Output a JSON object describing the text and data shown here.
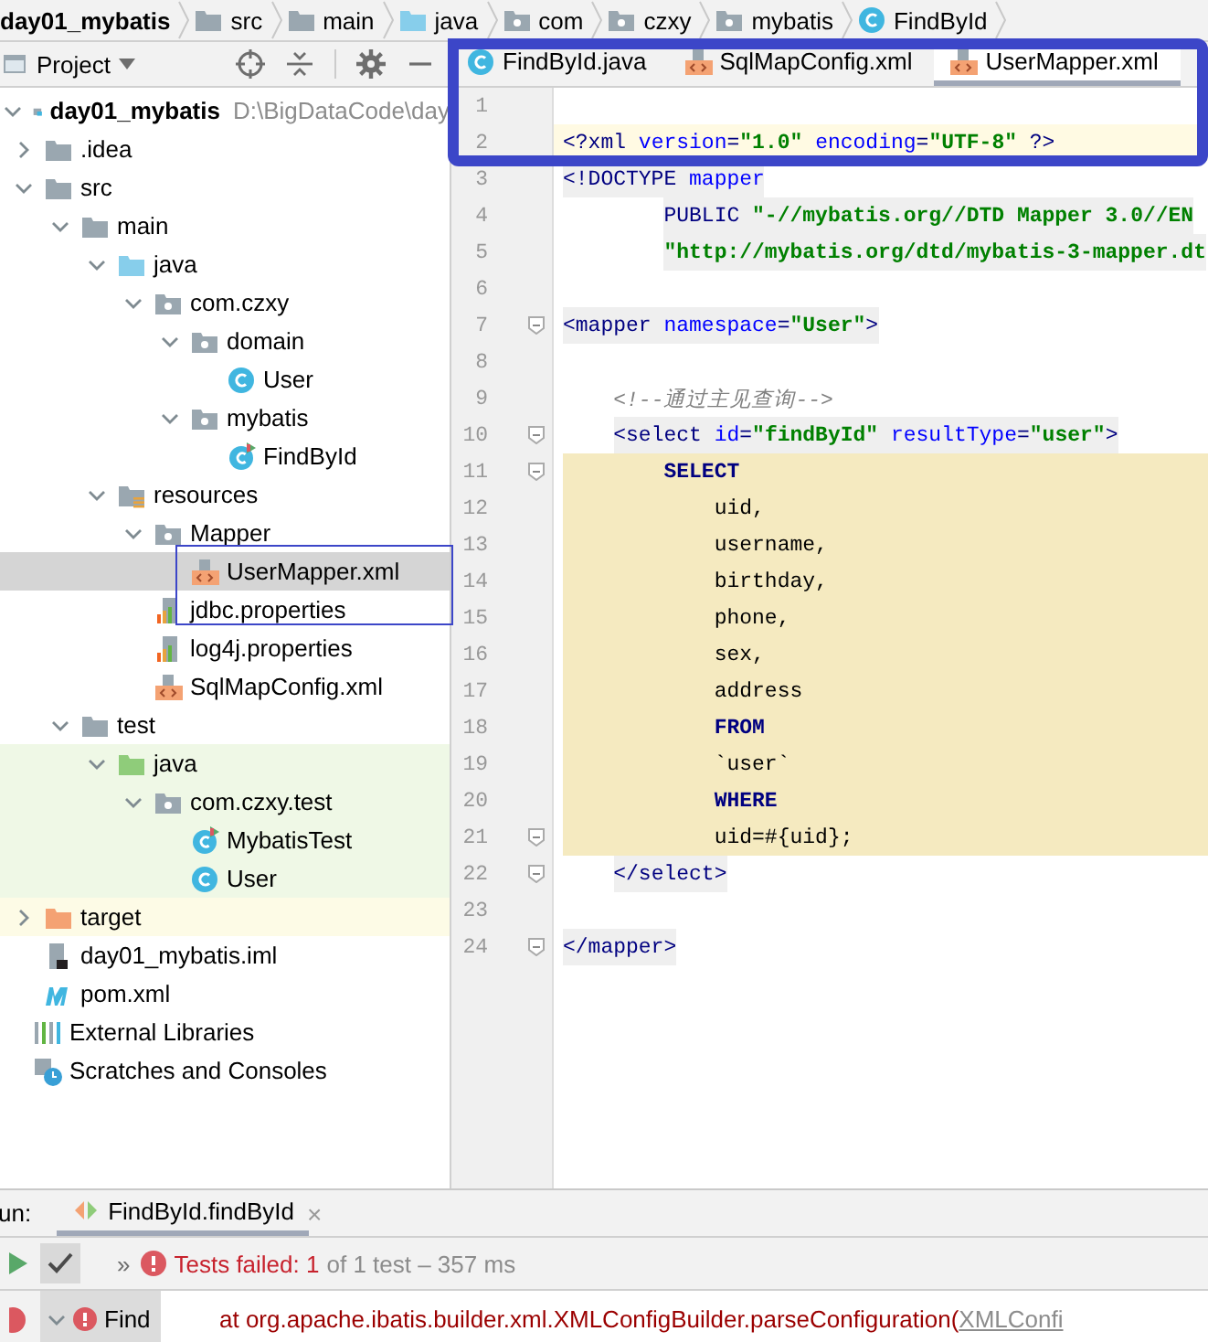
{
  "breadcrumbs": [
    {
      "label": "day01_mybatis"
    },
    {
      "label": "src",
      "kind": "folder"
    },
    {
      "label": "main",
      "kind": "folder"
    },
    {
      "label": "java",
      "kind": "source-root"
    },
    {
      "label": "com",
      "kind": "package"
    },
    {
      "label": "czxy",
      "kind": "package"
    },
    {
      "label": "mybatis",
      "kind": "package"
    },
    {
      "label": "FindById",
      "kind": "class"
    }
  ],
  "project_panel": {
    "title": "Project",
    "tree": [
      {
        "label": "day01_mybatis",
        "path": "D:\\BigDataCode\\day",
        "kind": "module",
        "expanded": true,
        "selected": false,
        "children": [
          {
            "label": ".idea",
            "kind": "folder",
            "expanded": false,
            "selected": false
          },
          {
            "label": "src",
            "kind": "folder",
            "expanded": true,
            "selected": false,
            "children": [
              {
                "label": "main",
                "kind": "folder",
                "expanded": true,
                "selected": false,
                "children": [
                  {
                    "label": "java",
                    "kind": "source-root",
                    "expanded": true,
                    "selected": false,
                    "children": [
                      {
                        "label": "com.czxy",
                        "kind": "package",
                        "expanded": true,
                        "selected": false,
                        "children": [
                          {
                            "label": "domain",
                            "kind": "package",
                            "expanded": true,
                            "selected": false,
                            "children": [
                              {
                                "label": "User",
                                "kind": "class",
                                "selected": false
                              }
                            ]
                          },
                          {
                            "label": "mybatis",
                            "kind": "package",
                            "expanded": true,
                            "selected": false,
                            "children": [
                              {
                                "label": "FindById",
                                "kind": "runnable-class",
                                "selected": false
                              }
                            ]
                          }
                        ]
                      }
                    ]
                  },
                  {
                    "label": "resources",
                    "kind": "resources",
                    "expanded": true,
                    "selected": false,
                    "children": [
                      {
                        "label": "Mapper",
                        "kind": "package",
                        "expanded": true,
                        "selected": false,
                        "children": [
                          {
                            "label": "UserMapper.xml",
                            "kind": "xml",
                            "selected": true
                          }
                        ]
                      },
                      {
                        "label": "jdbc.properties",
                        "kind": "properties",
                        "selected": false
                      },
                      {
                        "label": "log4j.properties",
                        "kind": "properties",
                        "selected": false
                      },
                      {
                        "label": "SqlMapConfig.xml",
                        "kind": "xml",
                        "selected": false
                      }
                    ]
                  }
                ]
              },
              {
                "label": "test",
                "kind": "folder",
                "expanded": true,
                "selected": false,
                "children": [
                  {
                    "label": "java",
                    "kind": "test-root",
                    "test_source": true,
                    "expanded": true,
                    "selected": false,
                    "children": [
                      {
                        "label": "com.czxy.test",
                        "kind": "package",
                        "test_source": true,
                        "expanded": true,
                        "selected": false,
                        "children": [
                          {
                            "label": "MybatisTest",
                            "kind": "runnable-class",
                            "test_source": true,
                            "selected": false
                          },
                          {
                            "label": "User",
                            "kind": "class",
                            "test_source": true,
                            "selected": false
                          }
                        ]
                      }
                    ]
                  }
                ]
              }
            ]
          },
          {
            "label": "target",
            "kind": "excluded",
            "excluded": true,
            "expanded": false,
            "selected": false
          },
          {
            "label": "day01_mybatis.iml",
            "kind": "iml",
            "selected": false
          },
          {
            "label": "pom.xml",
            "kind": "maven",
            "selected": false
          }
        ]
      },
      {
        "label": "External Libraries",
        "kind": "libraries",
        "selected": false
      },
      {
        "label": "Scratches and Consoles",
        "kind": "scratches",
        "selected": false
      }
    ]
  },
  "editor": {
    "tabs": [
      {
        "label": "FindById.java",
        "kind": "class",
        "selected": false
      },
      {
        "label": "SqlMapConfig.xml",
        "kind": "xml",
        "selected": false
      },
      {
        "label": "UserMapper.xml",
        "kind": "xml",
        "selected": true
      }
    ],
    "lines": [
      {
        "number": "1"
      },
      {
        "number": "2",
        "current": true,
        "segments": [
          {
            "kind": "tag",
            "text": "<?xml "
          },
          {
            "kind": "attr",
            "text": "version"
          },
          {
            "kind": "tag",
            "text": "="
          },
          {
            "kind": "value",
            "text": "\"1.0\" "
          },
          {
            "kind": "attr",
            "text": "encoding"
          },
          {
            "kind": "tag",
            "text": "="
          },
          {
            "kind": "value",
            "text": "\"UTF-8\" "
          },
          {
            "kind": "tag",
            "text": "?>"
          }
        ]
      },
      {
        "number": "3",
        "tag_bg": true,
        "segments": [
          {
            "kind": "tag",
            "text": "<!DOCTYPE "
          },
          {
            "kind": "attr",
            "text": "mapper"
          }
        ]
      },
      {
        "number": "4",
        "tag_bg": true,
        "segments": [
          {
            "kind": "tag",
            "text": "        PUBLIC "
          },
          {
            "kind": "value",
            "text": "\"-//mybatis.org//DTD Mapper 3.0//EN"
          }
        ]
      },
      {
        "number": "5",
        "tag_bg": true,
        "segments": [
          {
            "kind": "value",
            "text": "        \"http://mybatis.org/dtd/mybatis-3-mapper.dt"
          }
        ]
      },
      {
        "number": "6"
      },
      {
        "number": "7",
        "fold": true,
        "tag_bg": true,
        "segments": [
          {
            "kind": "tag",
            "text": "<mapper "
          },
          {
            "kind": "attr",
            "text": "namespace"
          },
          {
            "kind": "tag",
            "text": "="
          },
          {
            "kind": "value",
            "text": "\"User\""
          },
          {
            "kind": "tag",
            "text": ">"
          }
        ]
      },
      {
        "number": "8"
      },
      {
        "number": "9",
        "segments": [
          {
            "kind": "comment",
            "text": "    <!--通过主见查询-->"
          }
        ]
      },
      {
        "number": "10",
        "fold": true,
        "tag_bg": true,
        "segments": [
          {
            "kind": "tag",
            "text": "    <select "
          },
          {
            "kind": "attr",
            "text": "id"
          },
          {
            "kind": "tag",
            "text": "="
          },
          {
            "kind": "value",
            "text": "\"findById\" "
          },
          {
            "kind": "attr",
            "text": "resultType"
          },
          {
            "kind": "tag",
            "text": "="
          },
          {
            "kind": "value",
            "text": "\"user\""
          },
          {
            "kind": "tag",
            "text": ">"
          }
        ]
      },
      {
        "number": "11",
        "fold": true,
        "injected": true,
        "segments": [
          {
            "kind": "keyword",
            "text": "        SELECT"
          }
        ]
      },
      {
        "number": "12",
        "injected": true,
        "segments": [
          {
            "kind": "plain",
            "text": "            uid,"
          }
        ]
      },
      {
        "number": "13",
        "injected": true,
        "segments": [
          {
            "kind": "plain",
            "text": "            username,"
          }
        ]
      },
      {
        "number": "14",
        "injected": true,
        "segments": [
          {
            "kind": "plain",
            "text": "            birthday,"
          }
        ]
      },
      {
        "number": "15",
        "injected": true,
        "segments": [
          {
            "kind": "plain",
            "text": "            phone,"
          }
        ]
      },
      {
        "number": "16",
        "injected": true,
        "segments": [
          {
            "kind": "plain",
            "text": "            sex,"
          }
        ]
      },
      {
        "number": "17",
        "injected": true,
        "segments": [
          {
            "kind": "plain",
            "text": "            address"
          }
        ]
      },
      {
        "number": "18",
        "injected": true,
        "segments": [
          {
            "kind": "keyword",
            "text": "            FROM"
          }
        ]
      },
      {
        "number": "19",
        "injected": true,
        "segments": [
          {
            "kind": "plain",
            "text": "            `user`"
          }
        ]
      },
      {
        "number": "20",
        "injected": true,
        "segments": [
          {
            "kind": "keyword",
            "text": "            WHERE"
          }
        ]
      },
      {
        "number": "21",
        "fold": true,
        "injected": true,
        "segments": [
          {
            "kind": "plain",
            "text": "            uid=#{uid};"
          }
        ]
      },
      {
        "number": "22",
        "fold": true,
        "tag_bg": true,
        "segments": [
          {
            "kind": "tag",
            "text": "    </select>"
          }
        ]
      },
      {
        "number": "23"
      },
      {
        "number": "24",
        "fold": true,
        "tag_bg": true,
        "segments": [
          {
            "kind": "tag",
            "text": "</mapper>"
          }
        ]
      }
    ]
  },
  "run_panel": {
    "label": "un:",
    "tabs": [
      {
        "label": "FindById.findById",
        "close": "×",
        "selected": true
      }
    ],
    "expand": "»",
    "status": {
      "failed": "Tests failed: 1",
      "summary": "of 1 test – 357 ms"
    },
    "tree_item": {
      "label": "Find",
      "expanded": true
    },
    "console": [
      {
        "text": "at org.apache.ibatis.builder.xml.XMLConfigBuilder.parseConfiguration(",
        "link": "XMLConfi"
      }
    ]
  },
  "annotations": {
    "tab_frame": true,
    "file_frame": true
  }
}
